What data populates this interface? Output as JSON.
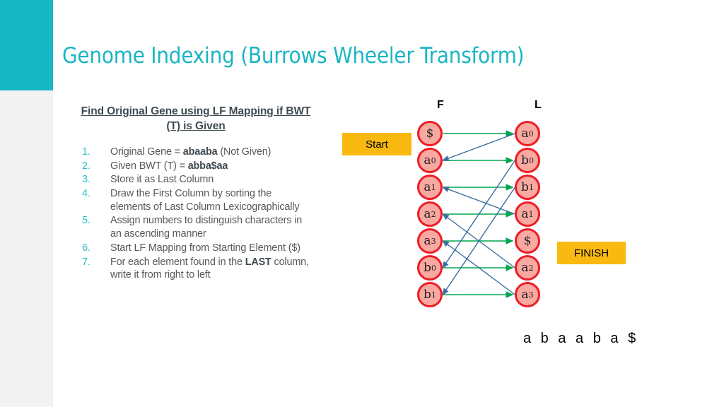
{
  "theme": {
    "accent_teal": "#17b6c4",
    "gray_strip": "#f2f2f2",
    "node_fill": "#f9a9a1",
    "node_border": "#ee1c25",
    "badge_amber": "#f9b911",
    "green_arrow": "#00a550",
    "blue_arrow": "#3a6f9f",
    "body_text": "#58585b"
  },
  "title": "Genome Indexing (Burrows Wheeler Transform)",
  "left_panel": {
    "heading": "Find Original Gene using LF Mapping if BWT (T) is Given",
    "steps": [
      {
        "n": "1.",
        "pre": "Original Gene = ",
        "bold": "abaaba",
        "post": " (Not Given)"
      },
      {
        "n": "2.",
        "pre": "Given BWT (T) = ",
        "bold": "abba$aa",
        "post": ""
      },
      {
        "n": "3.",
        "pre": "Store it as Last Column",
        "bold": "",
        "post": ""
      },
      {
        "n": "4.",
        "pre": "Draw the First Column by sorting the elements of Last Column Lexicographically",
        "bold": "",
        "post": ""
      },
      {
        "n": "5.",
        "pre": "Assign numbers to distinguish characters in an ascending manner",
        "bold": "",
        "post": ""
      },
      {
        "n": "6.",
        "pre": "Start LF Mapping from Starting Element ($)",
        "bold": "",
        "post": ""
      },
      {
        "n": "7.",
        "pre": "For each element found in the ",
        "bold": "LAST",
        "post": " column, write it from right to left"
      }
    ]
  },
  "diagram": {
    "column_headers": {
      "first": "F",
      "last": "L"
    },
    "badges": {
      "start": "Start",
      "finish": "FINISH"
    },
    "first_column": [
      {
        "ch": "$",
        "sub": ""
      },
      {
        "ch": "a",
        "sub": "0"
      },
      {
        "ch": "a",
        "sub": "1"
      },
      {
        "ch": "a",
        "sub": "2"
      },
      {
        "ch": "a",
        "sub": "3"
      },
      {
        "ch": "b",
        "sub": "0"
      },
      {
        "ch": "b",
        "sub": "1"
      }
    ],
    "last_column": [
      {
        "ch": "a",
        "sub": "0"
      },
      {
        "ch": "b",
        "sub": "0"
      },
      {
        "ch": "b",
        "sub": "1"
      },
      {
        "ch": "a",
        "sub": "1"
      },
      {
        "ch": "$",
        "sub": ""
      },
      {
        "ch": "a",
        "sub": "2"
      },
      {
        "ch": "a",
        "sub": "3"
      }
    ],
    "row_pairs": [
      0,
      1,
      2,
      3,
      4,
      5,
      6
    ],
    "lf_mapping": [
      {
        "from_last_row": 0,
        "to_first_row": 1
      },
      {
        "from_last_row": 1,
        "to_first_row": 5
      },
      {
        "from_last_row": 2,
        "to_first_row": 6
      },
      {
        "from_last_row": 3,
        "to_first_row": 2
      },
      {
        "from_last_row": 5,
        "to_first_row": 3
      },
      {
        "from_last_row": 6,
        "to_first_row": 4
      }
    ],
    "result_string": "a b a a b a $"
  }
}
